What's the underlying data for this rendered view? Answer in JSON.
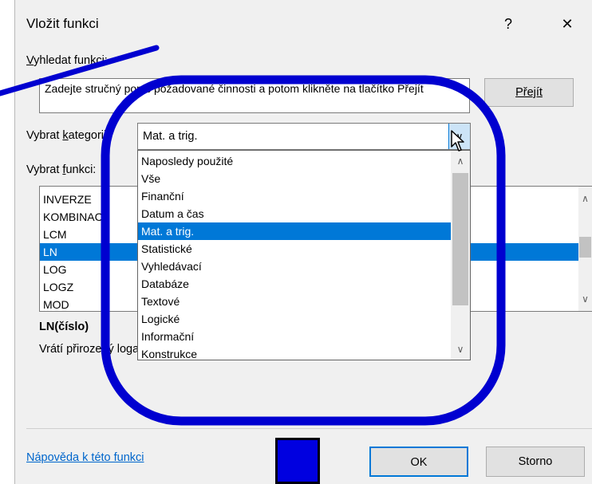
{
  "dialog": {
    "title": "Vložit funkci",
    "help_glyph": "?",
    "close_glyph": "✕"
  },
  "search": {
    "label_prefix": "",
    "label_accel": "V",
    "label_rest": "yhledat funkci:",
    "value": "Zadejte stručný popis požadované činnosti a potom klikněte na tlačítko Přejít",
    "go_button": "Přejít"
  },
  "category": {
    "label_before": "Vybrat ",
    "label_accel": "k",
    "label_after": "ategorii:",
    "selected": "Mat. a trig.",
    "options": [
      "Naposledy použité",
      "Vše",
      "Finanční",
      "Datum a čas",
      "Mat. a trig.",
      "Statistické",
      "Vyhledávací",
      "Databáze",
      "Textové",
      "Logické",
      "Informační",
      "Konstrukce"
    ],
    "selected_index": 4
  },
  "functions": {
    "label_before": "Vybrat ",
    "label_accel": "f",
    "label_after": "unkci:",
    "items": [
      "INVERZE",
      "KOMBINACE",
      "LCM",
      "LN",
      "LOG",
      "LOGZ",
      "MOD"
    ],
    "selected_index": 3
  },
  "description": {
    "signature": "LN(číslo)",
    "text": "Vrátí přirozený logaritmus čísla."
  },
  "footer": {
    "help_link": "Nápověda k této funkci",
    "ok_button": "OK",
    "cancel_button": "Storno"
  },
  "colors": {
    "annotation_blue": "#0000d0",
    "selection_blue": "#0078d7"
  }
}
